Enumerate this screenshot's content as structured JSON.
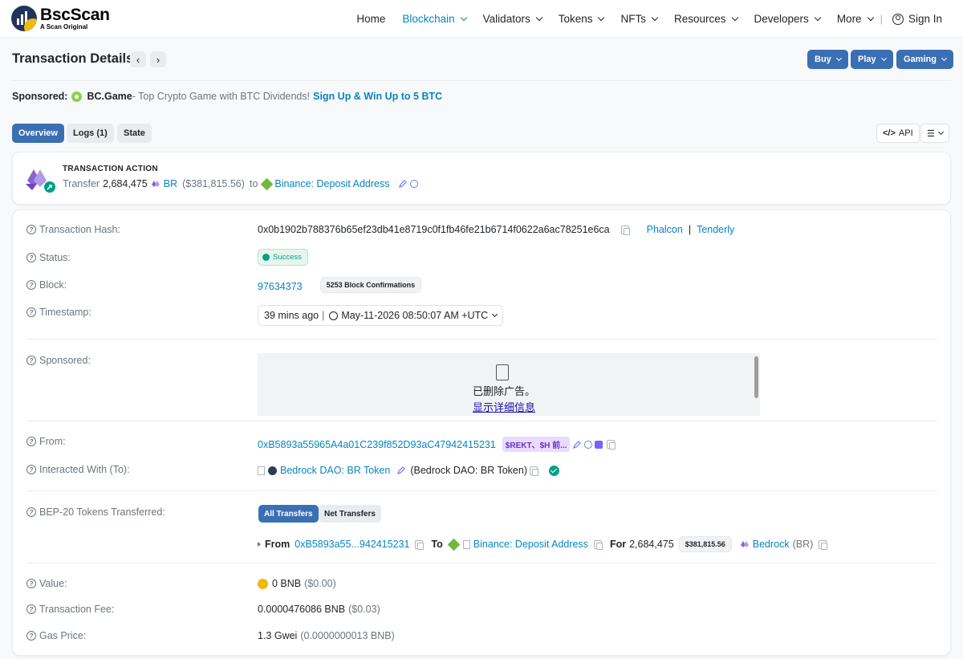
{
  "header": {
    "brand": "BscScan",
    "brand_sub": "A Scan Original",
    "nav": [
      "Home",
      "Blockchain",
      "Validators",
      "Tokens",
      "NFTs",
      "Resources",
      "Developers",
      "More"
    ],
    "sign_in": "Sign In"
  },
  "title": {
    "text": "Transaction Details",
    "prev": "‹",
    "next": "›",
    "buttons": [
      "Buy",
      "Play",
      "Gaming"
    ]
  },
  "sponsored": {
    "label": "Sponsored:",
    "name": "BC.Game",
    "text": " - Top Crypto Game with BTC Dividends!",
    "cta": "Sign Up & Win Up to 5 BTC"
  },
  "tabs": [
    "Overview",
    "Logs (1)",
    "State"
  ],
  "tools": {
    "api": "API"
  },
  "action": {
    "label": "TRANSACTION ACTION",
    "verb": "Transfer",
    "amount": "2,684,475",
    "token": "BR",
    "usd": "($381,815.56)",
    "to": "to",
    "dest": "Binance: Deposit Address"
  },
  "rows": {
    "hash_label": "Transaction Hash:",
    "hash": "0x0b1902b788376b65ef23db41e8719c0f1fb46fe21b6714f0622a6ac78251e6ca",
    "phalcon": "Phalcon",
    "sep": "|",
    "tenderly": "Tenderly",
    "status_label": "Status:",
    "status": "Success",
    "block_label": "Block:",
    "block": "97634373",
    "confirmations": "5253 Block Confirmations",
    "timestamp_label": "Timestamp:",
    "timestamp_ago": "39 mins ago",
    "timestamp": "May-11-2026 08:50:07 AM +UTC",
    "sponsored_label": "Sponsored:",
    "ad_removed": "已删除广告。",
    "ad_details": "显示详细信息",
    "from_label": "From:",
    "from": "0xB5893a55965A4a01C239f852D93aC47942415231",
    "from_tag": "$REKT、$H 前...",
    "to_label": "Interacted With (To):",
    "to_name": "Bedrock DAO: BR Token",
    "to_paren": "(Bedrock DAO: BR Token)",
    "tokens_label": "BEP-20 Tokens Transferred:",
    "tokens_tabs": [
      "All Transfers",
      "Net Transfers"
    ],
    "transfer_from_kw": "From",
    "transfer_from": "0xB5893a55...942415231",
    "transfer_to_kw": "To",
    "transfer_to": "Binance: Deposit Address",
    "transfer_for_kw": "For",
    "transfer_amount": "2,684,475",
    "transfer_usd": "$381,815.56",
    "transfer_token": "Bedrock",
    "transfer_symbol": "(BR)",
    "value_label": "Value:",
    "value": "0 BNB",
    "value_usd": "($0.00)",
    "fee_label": "Transaction Fee:",
    "fee": "0.0000476086 BNB",
    "fee_usd": "($0.03)",
    "gas_label": "Gas Price:",
    "gas": "1.3 Gwei",
    "gas_bnb": "(0.0000000013 BNB)"
  },
  "colors": {
    "accent": "#0784c3",
    "button": "#3b6fb4",
    "success": "#00a186",
    "bnb": "#f0b90b"
  }
}
